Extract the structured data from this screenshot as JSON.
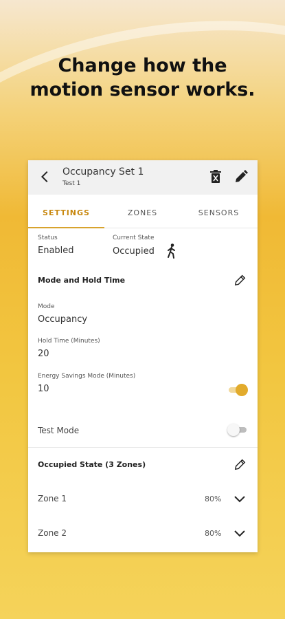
{
  "headline": {
    "line1": "Change how the",
    "line2": "motion sensor works."
  },
  "header": {
    "title": "Occupancy Set 1",
    "subtitle": "Test 1",
    "icons": [
      "back-arrow-icon",
      "trash-icon",
      "pencil-icon"
    ]
  },
  "tabs": [
    {
      "label": "SETTINGS",
      "active": true
    },
    {
      "label": "ZONES",
      "active": false
    },
    {
      "label": "SENSORS",
      "active": false
    }
  ],
  "status": {
    "status_label": "Status",
    "status_value": "Enabled",
    "state_label": "Current State",
    "state_value": "Occupied"
  },
  "mode_section": {
    "title": "Mode and Hold Time",
    "mode_label": "Mode",
    "mode_value": "Occupancy",
    "hold_label": "Hold Time (Minutes)",
    "hold_value": "20",
    "energy_label": "Energy Savings Mode (Minutes)",
    "energy_value": "10",
    "energy_toggle_on": true,
    "test_label": "Test Mode",
    "test_toggle_on": false
  },
  "occupied_section": {
    "title": "Occupied State (3 Zones)",
    "zones": [
      {
        "name": "Zone 1",
        "level": "80%"
      },
      {
        "name": "Zone 2",
        "level": "80%"
      }
    ]
  },
  "colors": {
    "accent": "#d8a32e",
    "tab_active_text": "#c8880f",
    "toggle_on": "#e2ab2c",
    "toggle_off": "#f2f2f2"
  }
}
